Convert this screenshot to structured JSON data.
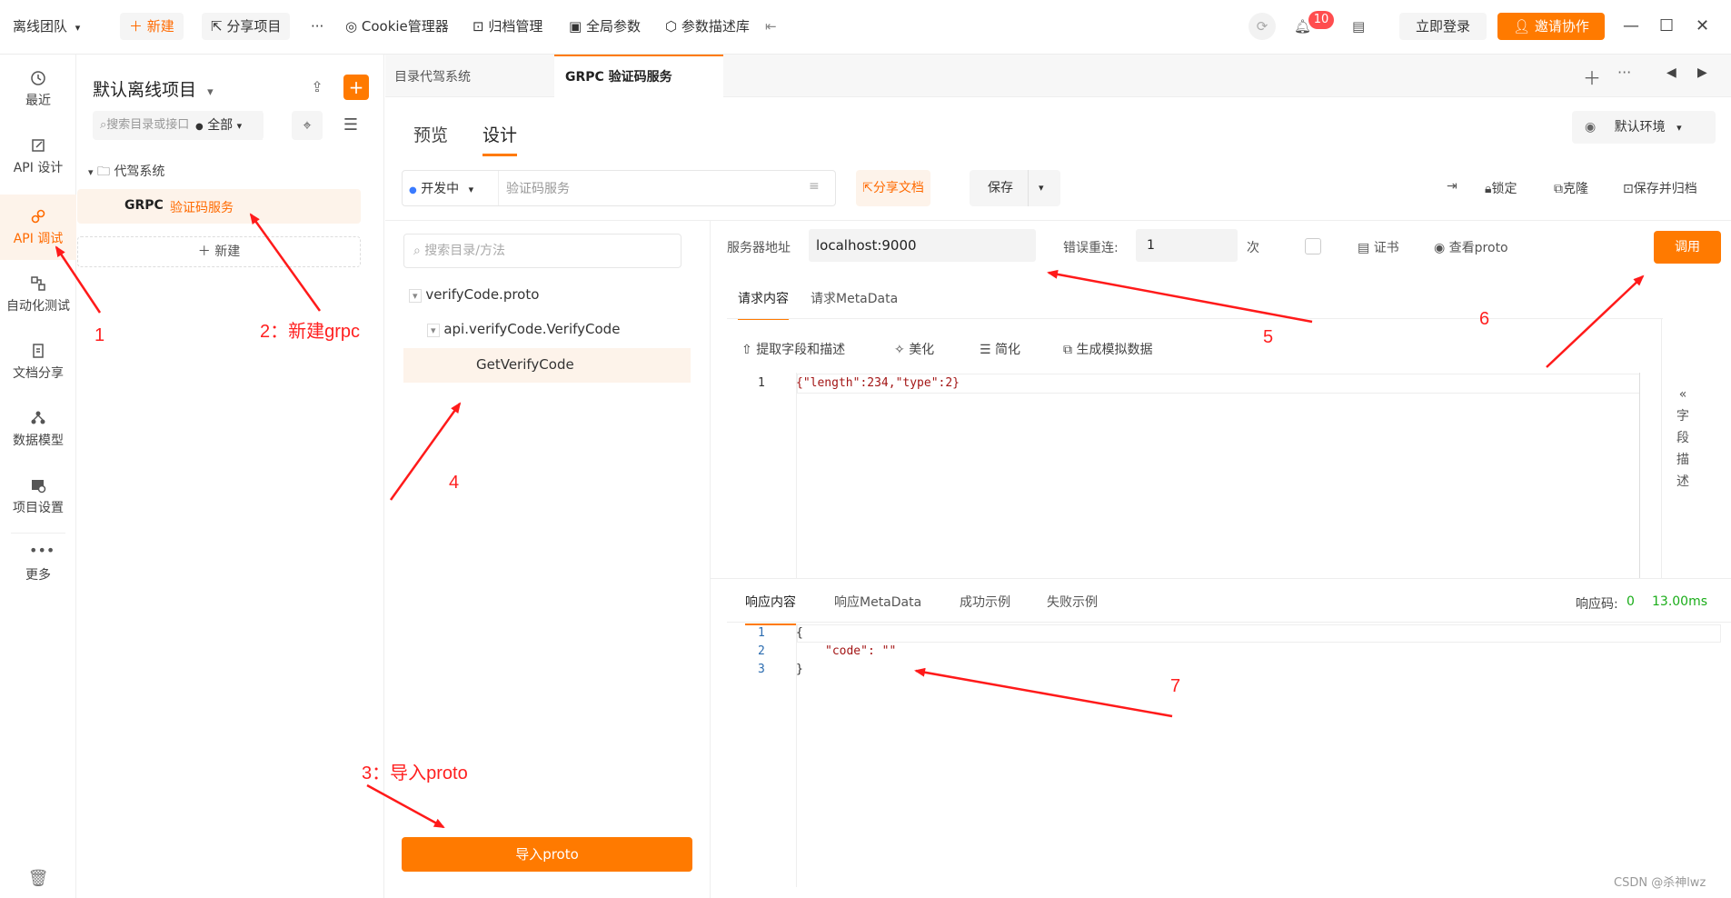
{
  "topbar": {
    "team": "离线团队",
    "new_btn": "新建",
    "share_project": "分享项目",
    "more": "···",
    "cookie_manager": "Cookie管理器",
    "archive_manage": "归档管理",
    "global_params": "全局参数",
    "param_lib": "参数描述库",
    "notif_count": "10",
    "login": "立即登录",
    "invite": "邀请协作"
  },
  "rail": {
    "items": [
      {
        "label": "最近",
        "icon": "clock-icon"
      },
      {
        "label": "API 设计",
        "icon": "edit-icon"
      },
      {
        "label": "API 调试",
        "icon": "link-icon"
      },
      {
        "label": "自动化测试",
        "icon": "flow-icon"
      },
      {
        "label": "文档分享",
        "icon": "doc-icon"
      },
      {
        "label": "数据模型",
        "icon": "model-icon"
      },
      {
        "label": "项目设置",
        "icon": "settings-icon"
      },
      {
        "label": "更多",
        "icon": "dots-icon"
      }
    ]
  },
  "project": {
    "title": "默认离线项目",
    "search_placeholder": "搜索目录或接口",
    "filter": "全部",
    "folder": "代驾系统",
    "item_tag": "GRPC",
    "item_name": "验证码服务",
    "new_label": "新建"
  },
  "tabs": [
    {
      "label": "目录代驾系统"
    },
    {
      "label": "GRPC 验证码服务"
    }
  ],
  "main": {
    "mode_tabs": [
      "预览",
      "设计"
    ],
    "env": "默认环境",
    "status": "开发中",
    "name_placeholder": "验证码服务",
    "share_doc": "分享文档",
    "save": "保存",
    "lock": "锁定",
    "clone": "克隆",
    "save_archive": "保存并归档"
  },
  "tree": {
    "search_placeholder": "搜索目录/方法",
    "proto_file": "verifyCode.proto",
    "service": "api.verifyCode.VerifyCode",
    "method": "GetVerifyCode",
    "import_btn": "导入proto"
  },
  "request": {
    "server_label": "服务器地址",
    "server_value": "localhost:9000",
    "retry_label": "错误重连:",
    "retry_value": "1",
    "retry_unit": "次",
    "cert": "证书",
    "view_proto": "查看proto",
    "invoke": "调用",
    "tabs": [
      "请求内容",
      "请求MetaData"
    ],
    "tools": [
      "提取字段和描述",
      "美化",
      "简化",
      "生成模拟数据"
    ],
    "line_no": "1",
    "code_line": "{\"length\":234,\"type\":2}",
    "side_label": [
      "字",
      "段",
      "描",
      "述"
    ]
  },
  "response": {
    "tabs": [
      "响应内容",
      "响应MetaData",
      "成功示例",
      "失败示例"
    ],
    "code_label": "响应码:",
    "code_value": "0",
    "time": "13.00ms",
    "lines": [
      {
        "no": "1",
        "text": "{"
      },
      {
        "no": "2",
        "text": "\"code\": \"\""
      },
      {
        "no": "3",
        "text": "}"
      }
    ]
  },
  "annotations": {
    "a1": "1",
    "a2": "2：新建grpc",
    "a3": "3：导入proto",
    "a4": "4",
    "a5": "5",
    "a6": "6",
    "a7": "7"
  },
  "watermark": "CSDN @杀神lwz",
  "colors": {
    "accent": "#ff6a00",
    "annotation": "#ff2020",
    "success": "#1aad19"
  }
}
